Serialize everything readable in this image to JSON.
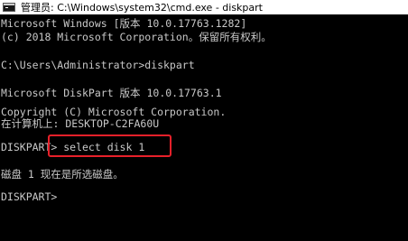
{
  "window": {
    "title": "管理员: C:\\Windows\\system32\\cmd.exe - diskpart",
    "icon": "cmd-icon"
  },
  "console": {
    "lines": [
      "Microsoft Windows [版本 10.0.17763.1282]",
      "(c) 2018 Microsoft Corporation。保留所有权利。",
      "C:\\Users\\Administrator>diskpart",
      "Microsoft DiskPart 版本 10.0.17763.1",
      "Copyright (C) Microsoft Corporation.",
      "在计算机上: DESKTOP-C2FA60U",
      "DISKPART> select disk 1",
      "磁盘 1 现在是所选磁盘。",
      "DISKPART>"
    ]
  },
  "colors": {
    "background": "#000000",
    "text": "#c8c8c8",
    "titlebar": "#ffffff",
    "highlight": "#e8202a"
  }
}
